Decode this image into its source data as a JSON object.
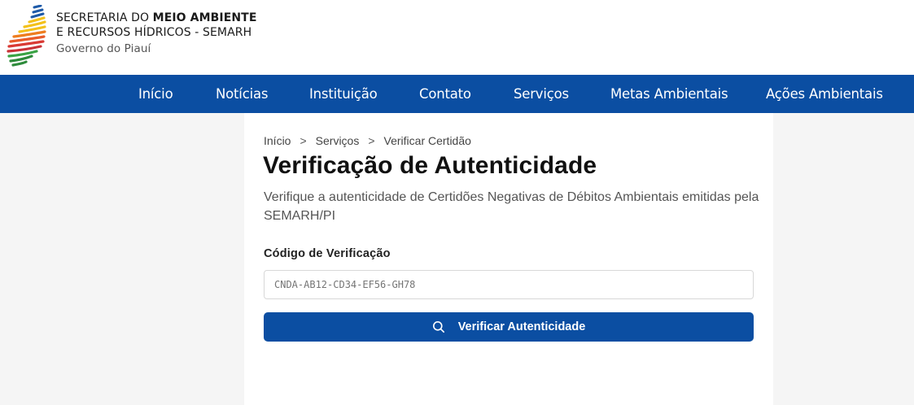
{
  "header": {
    "org_line1_prefix": "SECRETARIA DO ",
    "org_line1_bold": "MEIO AMBIENTE",
    "org_line2": "E RECURSOS HÍDRICOS - SEMARH",
    "gov_line": "Governo do Piauí",
    "logo_icon": "semarh-logo-icon"
  },
  "nav": {
    "items": [
      {
        "label": "Início"
      },
      {
        "label": "Notícias"
      },
      {
        "label": "Instituição"
      },
      {
        "label": "Contato"
      },
      {
        "label": "Serviços"
      },
      {
        "label": "Metas Ambientais"
      },
      {
        "label": "Ações Ambientais"
      }
    ]
  },
  "breadcrumb": {
    "items": [
      "Início",
      "Serviços",
      "Verificar Certidão"
    ],
    "separator": ">"
  },
  "page": {
    "title": "Verificação de Autenticidade",
    "description": "Verifique a autenticidade de Certidões Negativas de Débitos Ambientais emitidas pela SEMARH/PI"
  },
  "form": {
    "code_label": "Código de Verificação",
    "code_placeholder": "CNDA-AB12-CD34-EF56-GH78",
    "code_value": "",
    "submit_label": "Verificar Autenticidade",
    "submit_icon": "search-icon"
  },
  "colors": {
    "primary": "#0b4ea2",
    "background": "#f5f5f5",
    "panel": "#ffffff"
  }
}
